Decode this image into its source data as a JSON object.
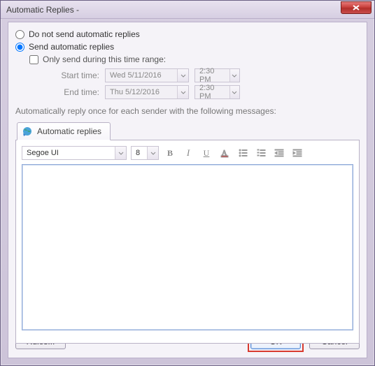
{
  "window": {
    "title": "Automatic Replies -"
  },
  "options": {
    "do_not_send_label": "Do not send automatic replies",
    "send_label": "Send automatic replies",
    "only_range_label": "Only send during this time range:",
    "start_label": "Start time:",
    "end_label": "End time:",
    "start_date": "Wed 5/11/2016",
    "start_time": "2:30 PM",
    "end_date": "Thu 5/12/2016",
    "end_time": "2:30 PM"
  },
  "section_label": "Automatically reply once for each sender with the following messages:",
  "tab": {
    "label": "Automatic replies"
  },
  "editor": {
    "font_name": "Segoe UI",
    "font_size": "8",
    "content": ""
  },
  "buttons": {
    "rules": "Rules...",
    "ok": "OK",
    "cancel": "Cancel"
  }
}
